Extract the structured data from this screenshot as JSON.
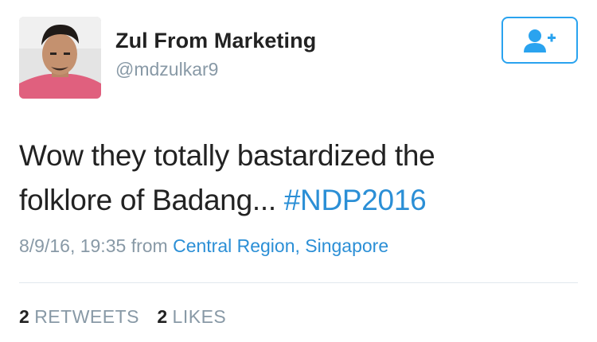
{
  "user": {
    "display_name": "Zul From Marketing",
    "handle": "@mdzulkar9",
    "avatar_icon": "user-avatar-photo"
  },
  "follow_button": {
    "icon": "add-user-icon",
    "color": "#2aa3ef"
  },
  "tweet": {
    "text_line1": "Wow they totally bastardized the",
    "text_line2_prefix": "folklore of Badang... ",
    "hashtag": "#NDP2016",
    "timestamp": "8/9/16, 19:35",
    "from_label": "from",
    "location": "Central Region, Singapore"
  },
  "stats": {
    "retweets_count": "2",
    "retweets_label": "RETWEETS",
    "likes_count": "2",
    "likes_label": "LIKES"
  },
  "colors": {
    "link": "#2b8fd6",
    "muted": "#8899a6",
    "text": "#222222",
    "divider": "#e1e8ed"
  }
}
